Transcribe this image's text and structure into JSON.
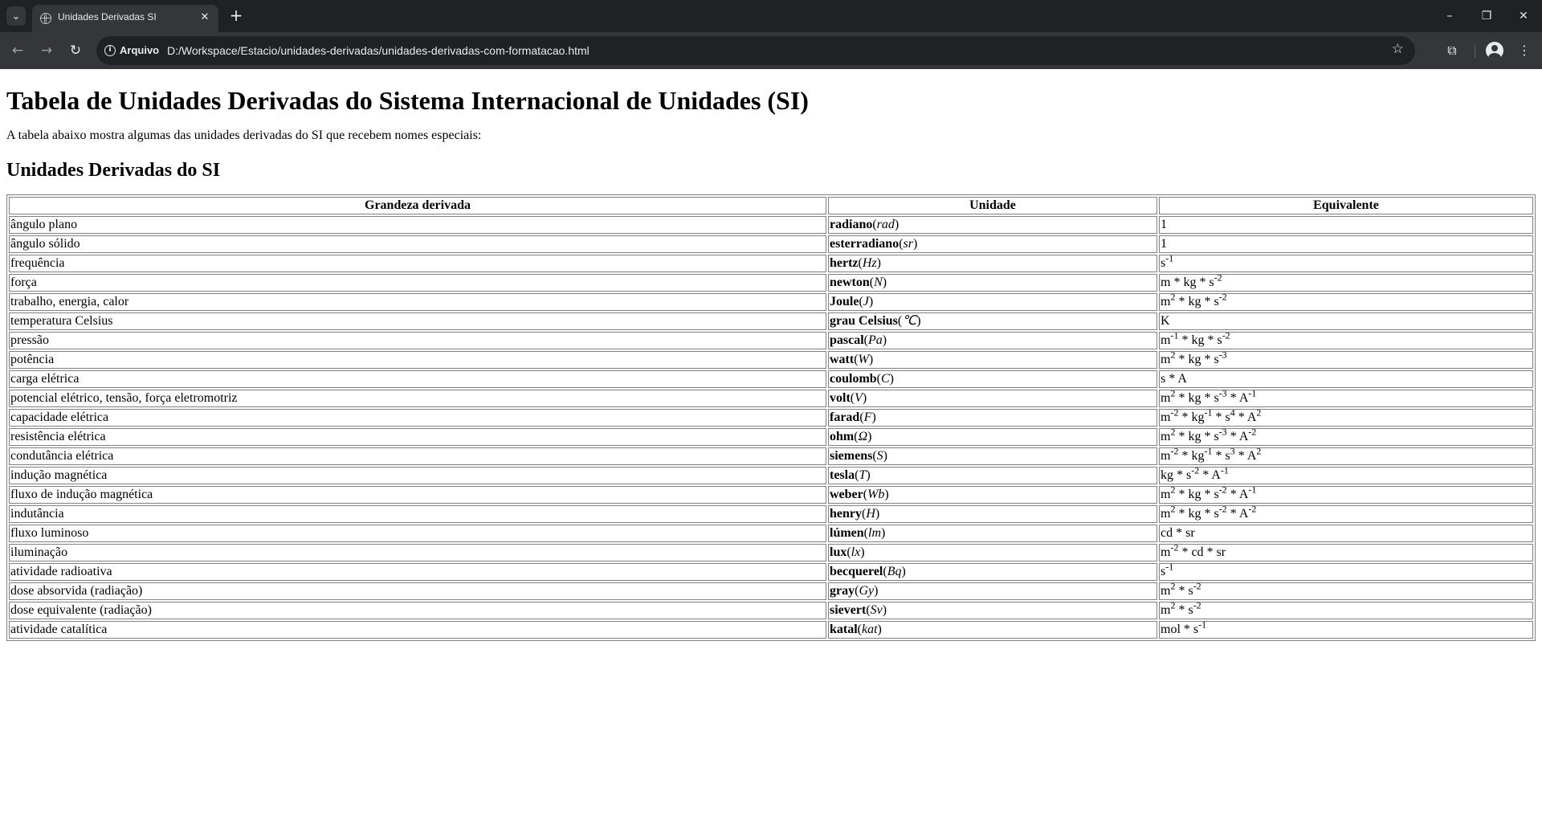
{
  "browser": {
    "tab_title": "Unidades Derivadas SI",
    "scheme_label": "Arquivo",
    "url": "D:/Workspace/Estacio/unidades-derivadas/unidades-derivadas-com-formatacao.html"
  },
  "page": {
    "title": "Tabela de Unidades Derivadas do Sistema Internacional de Unidades (SI)",
    "intro": "A tabela abaixo mostra algumas das unidades derivadas do SI que recebem nomes especiais:",
    "subtitle": "Unidades Derivadas do SI"
  },
  "table": {
    "headers": [
      "Grandeza derivada",
      "Unidade",
      "Equivalente"
    ],
    "rows": [
      {
        "quantity": "ângulo plano",
        "unit": "radiano",
        "symbol": "rad",
        "equivalent": [
          [
            "1",
            ""
          ]
        ]
      },
      {
        "quantity": "ângulo sólido",
        "unit": "esterradiano",
        "symbol": "sr",
        "equivalent": [
          [
            "1",
            ""
          ]
        ]
      },
      {
        "quantity": "frequência",
        "unit": "hertz",
        "symbol": "Hz",
        "equivalent": [
          [
            "s",
            "-1"
          ]
        ]
      },
      {
        "quantity": "força",
        "unit": "newton",
        "symbol": "N",
        "equivalent": [
          [
            "m",
            ""
          ],
          [
            "kg",
            ""
          ],
          [
            "s",
            "-2"
          ]
        ]
      },
      {
        "quantity": "trabalho, energia, calor",
        "unit": "Joule",
        "symbol": "J",
        "equivalent": [
          [
            "m",
            "2"
          ],
          [
            "kg",
            ""
          ],
          [
            "s",
            "-2"
          ]
        ]
      },
      {
        "quantity": "temperatura Celsius",
        "unit": "grau Celsius",
        "symbol": "℃",
        "equivalent": [
          [
            "K",
            ""
          ]
        ]
      },
      {
        "quantity": "pressão",
        "unit": "pascal",
        "symbol": "Pa",
        "equivalent": [
          [
            "m",
            "-1"
          ],
          [
            "kg",
            ""
          ],
          [
            "s",
            "-2"
          ]
        ]
      },
      {
        "quantity": "potência",
        "unit": "watt",
        "symbol": "W",
        "equivalent": [
          [
            "m",
            "2"
          ],
          [
            "kg",
            ""
          ],
          [
            "s",
            "-3"
          ]
        ]
      },
      {
        "quantity": "carga elétrica",
        "unit": "coulomb",
        "symbol": "C",
        "equivalent": [
          [
            "s",
            ""
          ],
          [
            "A",
            ""
          ]
        ]
      },
      {
        "quantity": "potencial elétrico, tensão, força eletromotriz",
        "unit": "volt",
        "symbol": "V",
        "equivalent": [
          [
            "m",
            "2"
          ],
          [
            "kg",
            ""
          ],
          [
            "s",
            "-3"
          ],
          [
            "A",
            "-1"
          ]
        ]
      },
      {
        "quantity": "capacidade elétrica",
        "unit": "farad",
        "symbol": "F",
        "equivalent": [
          [
            "m",
            "-2"
          ],
          [
            "kg",
            "-1"
          ],
          [
            "s",
            "4"
          ],
          [
            "A",
            "2"
          ]
        ]
      },
      {
        "quantity": "resistência elétrica",
        "unit": "ohm",
        "symbol": "Ω",
        "equivalent": [
          [
            "m",
            "2"
          ],
          [
            "kg",
            ""
          ],
          [
            "s",
            "-3"
          ],
          [
            "A",
            "-2"
          ]
        ]
      },
      {
        "quantity": "condutância elétrica",
        "unit": "siemens",
        "symbol": "S",
        "equivalent": [
          [
            "m",
            "-2"
          ],
          [
            "kg",
            "-1"
          ],
          [
            "s",
            "3"
          ],
          [
            "A",
            "2"
          ]
        ]
      },
      {
        "quantity": "indução magnética",
        "unit": "tesla",
        "symbol": "T",
        "equivalent": [
          [
            "kg",
            ""
          ],
          [
            "s",
            "-2"
          ],
          [
            "A",
            "-1"
          ]
        ]
      },
      {
        "quantity": "fluxo de indução magnética",
        "unit": "weber",
        "symbol": "Wb",
        "equivalent": [
          [
            "m",
            "2"
          ],
          [
            "kg",
            ""
          ],
          [
            "s",
            "-2"
          ],
          [
            "A",
            "-1"
          ]
        ]
      },
      {
        "quantity": "indutância",
        "unit": "henry",
        "symbol": "H",
        "equivalent": [
          [
            "m",
            "2"
          ],
          [
            "kg",
            ""
          ],
          [
            "s",
            "-2"
          ],
          [
            "A",
            "-2"
          ]
        ]
      },
      {
        "quantity": "fluxo luminoso",
        "unit": "lúmen",
        "symbol": "lm",
        "equivalent": [
          [
            "cd",
            ""
          ],
          [
            "sr",
            ""
          ]
        ]
      },
      {
        "quantity": "iluminação",
        "unit": "lux",
        "symbol": "lx",
        "equivalent": [
          [
            "m",
            "-2"
          ],
          [
            "cd",
            ""
          ],
          [
            "sr",
            ""
          ]
        ]
      },
      {
        "quantity": "atividade radioativa",
        "unit": "becquerel",
        "symbol": "Bq",
        "equivalent": [
          [
            "s",
            "-1"
          ]
        ]
      },
      {
        "quantity": "dose absorvida (radiação)",
        "unit": "gray",
        "symbol": "Gy",
        "equivalent": [
          [
            "m",
            "2"
          ],
          [
            "s",
            "-2"
          ]
        ]
      },
      {
        "quantity": "dose equivalente (radiação)",
        "unit": "sievert",
        "symbol": "Sv",
        "equivalent": [
          [
            "m",
            "2"
          ],
          [
            "s",
            "-2"
          ]
        ]
      },
      {
        "quantity": "atividade catalítica",
        "unit": "katal",
        "symbol": "kat",
        "equivalent": [
          [
            "mol",
            ""
          ],
          [
            "s",
            "-1"
          ]
        ]
      }
    ]
  }
}
